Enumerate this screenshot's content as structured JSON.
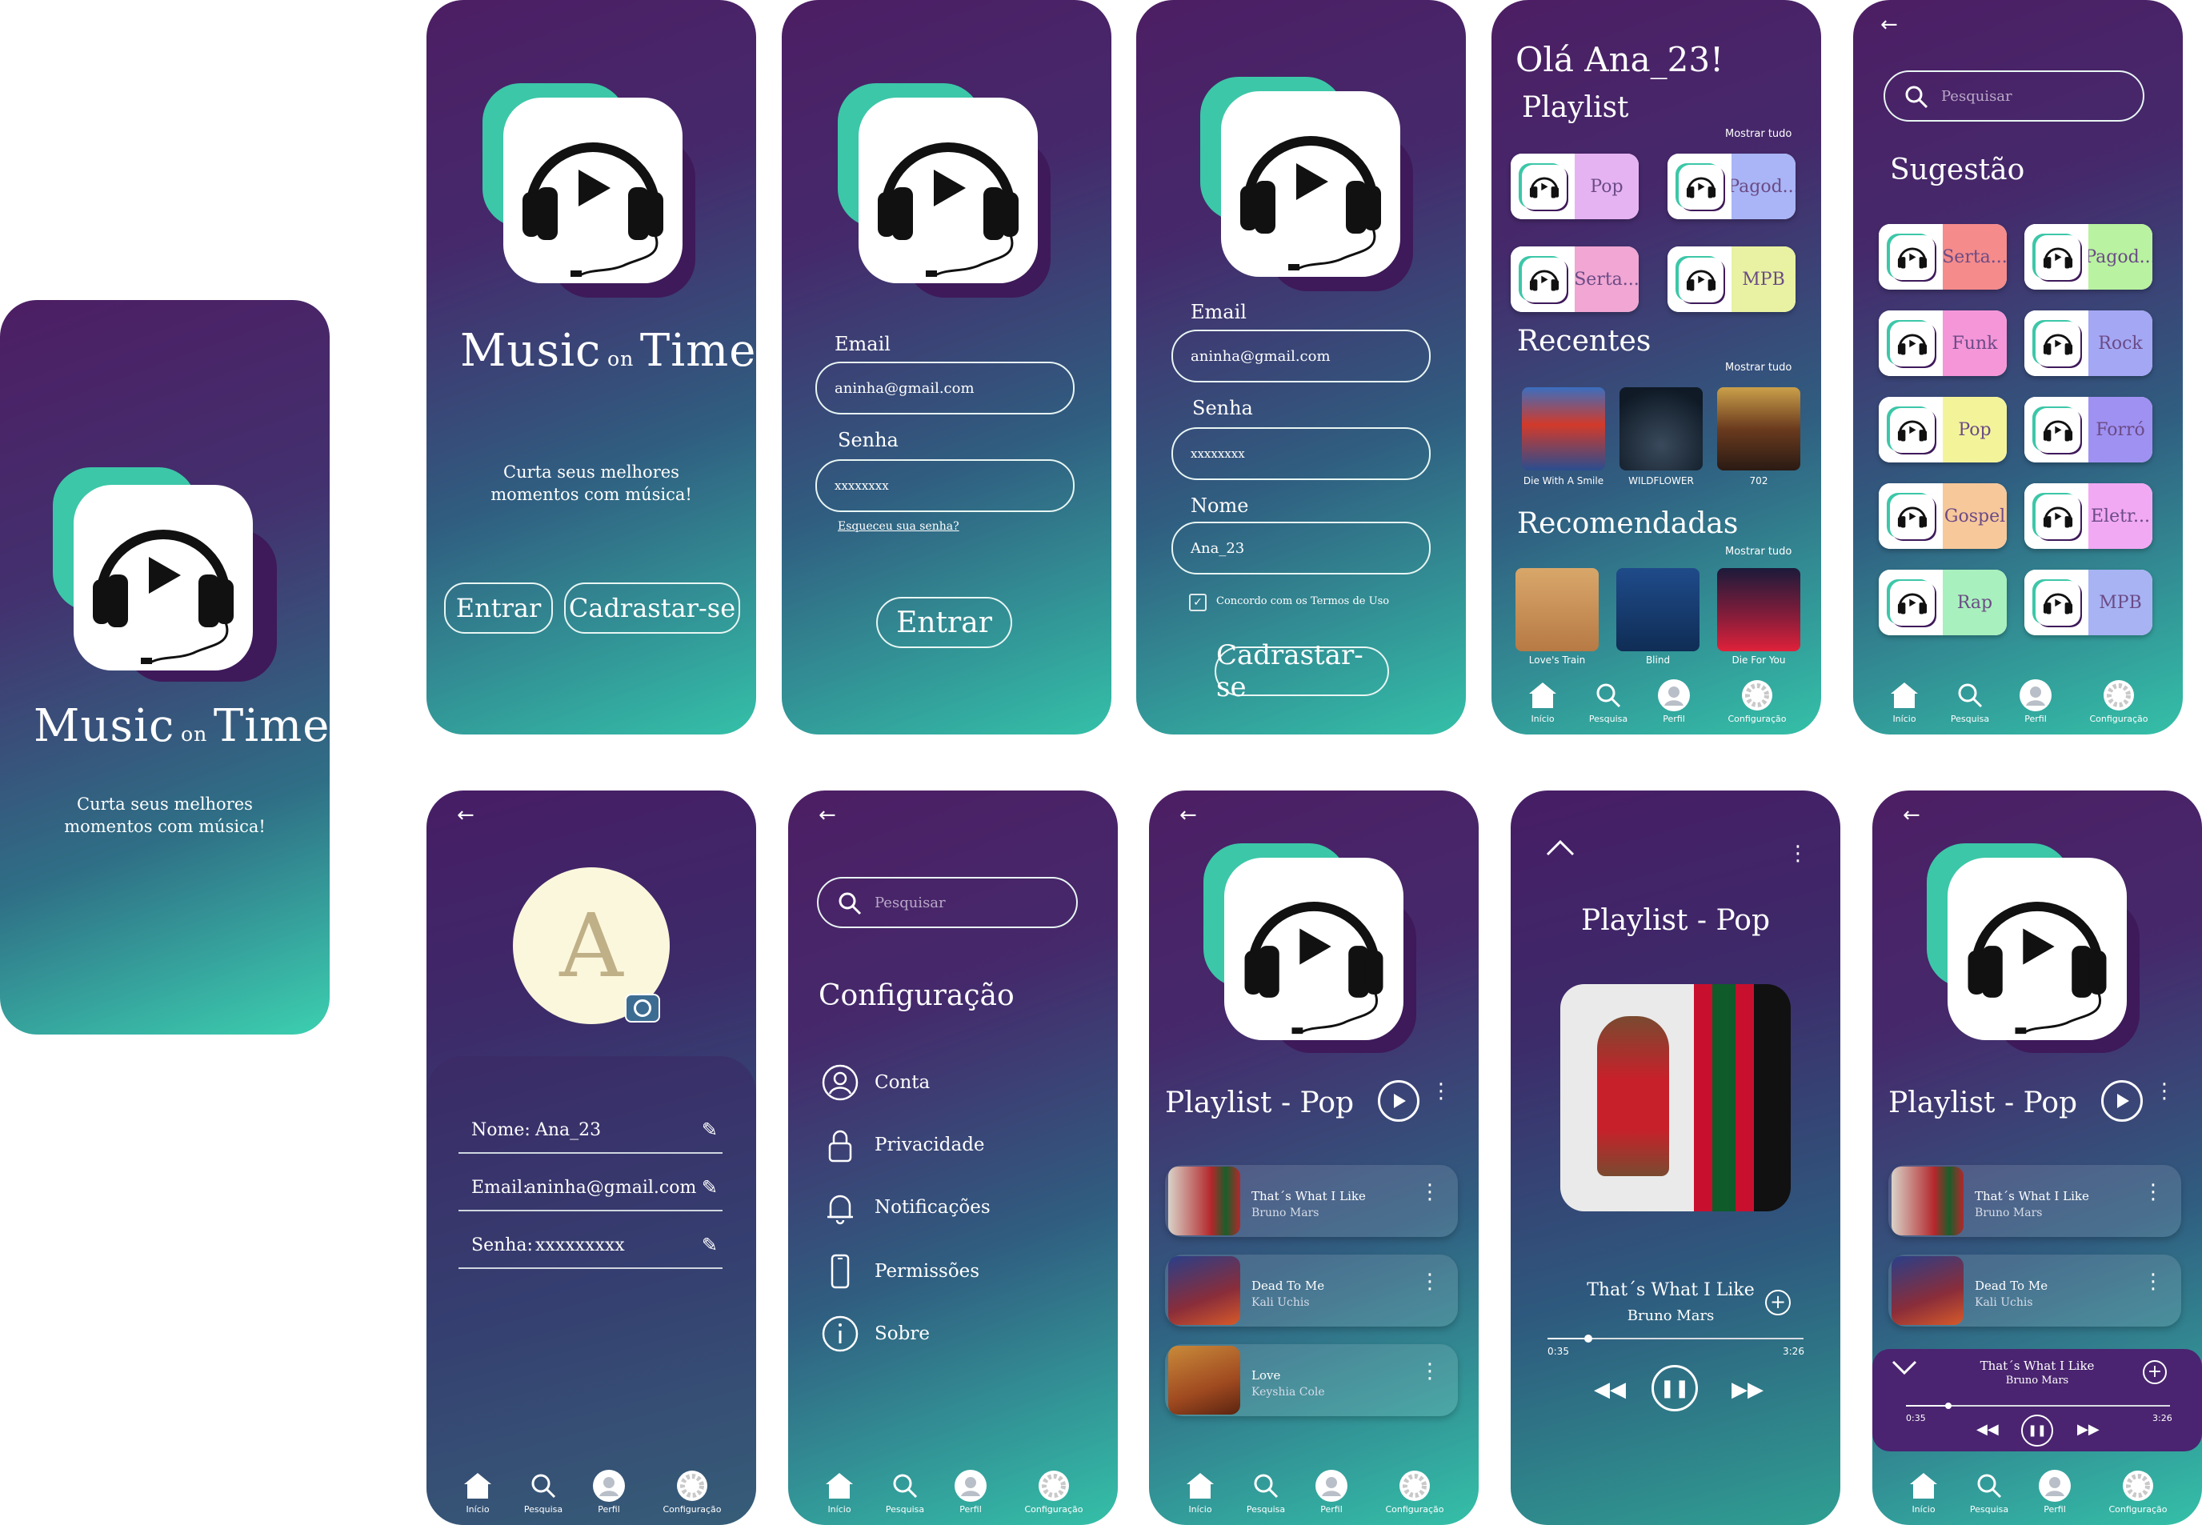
{
  "brand": {
    "name_left": "Music",
    "name_on": "on",
    "name_right": "Time",
    "tagline_line1": "Curta seus melhores",
    "tagline_line2": "momentos com música!"
  },
  "welcome": {
    "login_button": "Entrar",
    "signup_button": "Cadrastar-se"
  },
  "login": {
    "email_label": "Email",
    "email_value": "aninha@gmail.com",
    "password_label": "Senha",
    "password_value": "xxxxxxxx",
    "forgot_link": "Esqueceu sua senha?",
    "submit_button": "Entrar"
  },
  "signup": {
    "email_label": "Email",
    "email_value": "aninha@gmail.com",
    "password_label": "Senha",
    "password_value": "xxxxxxxx",
    "name_label": "Nome",
    "name_value": "Ana_23",
    "terms_label": "Concordo com os Termos de Uso",
    "submit_button": "Cadrastar-se"
  },
  "home": {
    "greeting": "Olá Ana_23!",
    "playlist_title": "Playlist",
    "show_all": "Mostrar tudo",
    "playlists": [
      "Pop",
      "Pagod...",
      "Serta...",
      "MPB"
    ],
    "playlist_colors": [
      "#e6b3f2",
      "#a9b5f6",
      "#f1a6d3",
      "#e8f2a2"
    ],
    "recent_title": "Recentes",
    "recent": [
      "Die With A Smile",
      "WILDFLOWER",
      "702"
    ],
    "recommended_title": "Recomendadas",
    "recommended": [
      "Love's Train",
      "Blind",
      "Die For You"
    ]
  },
  "search": {
    "placeholder": "Pesquisar",
    "suggestion_title": "Sugestão",
    "genres": [
      "Serta...",
      "Pagod...",
      "Funk",
      "Rock",
      "Pop",
      "Forró",
      "Gospel",
      "Eletr...",
      "Rap",
      "MPB"
    ],
    "genre_colors": [
      "#f58b8b",
      "#b9f2a0",
      "#f596d9",
      "#a4a7f4",
      "#f3f49a",
      "#9f91f2",
      "#f7c89a",
      "#f2a9f4",
      "#a8f0bd",
      "#a8b3f4"
    ]
  },
  "profile": {
    "avatar_letter": "A",
    "name_label": "Nome:",
    "name_value": "Ana_23",
    "email_label": "Email:",
    "email_value": "aninha@gmail.com",
    "password_label": "Senha:",
    "password_value": "xxxxxxxxx"
  },
  "settings": {
    "placeholder": "Pesquisar",
    "title": "Configuração",
    "items": [
      "Conta",
      "Privacidade",
      "Notificações",
      "Permissões",
      "Sobre"
    ]
  },
  "playlist": {
    "title": "Playlist - Pop",
    "tracks": [
      {
        "title": "That´s What I Like",
        "artist": "Bruno Mars"
      },
      {
        "title": "Dead To Me",
        "artist": "Kali Uchis"
      },
      {
        "title": "Love",
        "artist": "Keyshia Cole"
      }
    ]
  },
  "player": {
    "title": "Playlist - Pop",
    "song": "That´s What I Like",
    "artist": "Bruno Mars",
    "elapsed": "0:35",
    "duration": "3:26",
    "progress": 0.16
  },
  "nav": {
    "home": "Início",
    "search": "Pesquisa",
    "profile": "Perfil",
    "settings": "Configuração"
  },
  "colors": {
    "teal": "#3cc7a8",
    "purple": "#4d1e64",
    "accent_text": "#6b4b86"
  }
}
